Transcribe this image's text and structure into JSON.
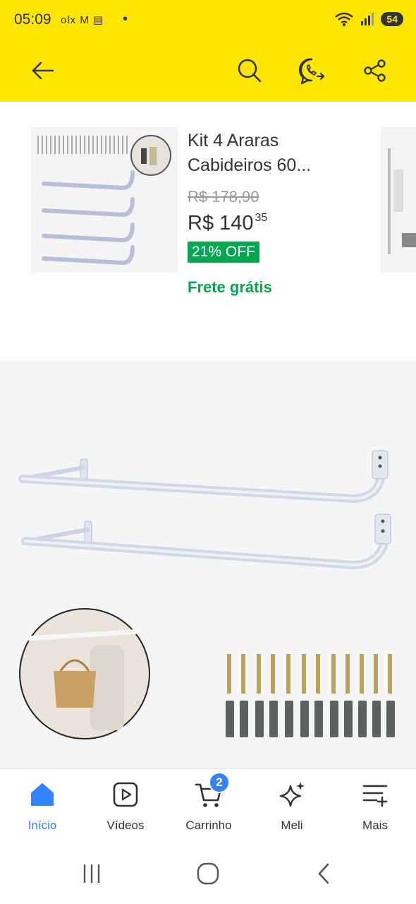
{
  "status_bar": {
    "time": "05:09",
    "notifications": "olx M ▤",
    "dot": "•",
    "battery": "54"
  },
  "app_bar": {
    "back_icon": "arrow-left-icon",
    "search_icon": "search-icon",
    "whatsapp_icon": "whatsapp-share-icon",
    "share_icon": "share-icon",
    "background_color": "#ffe600"
  },
  "recommendation": {
    "title": "Kit 4 Araras Cabideiros 60...",
    "old_price": "R$ 178,90",
    "price_main": "R$ 140",
    "price_cents": "35",
    "discount": "21% OFF",
    "shipping": "Frete grátis",
    "discount_color": "#00a650"
  },
  "bottom_nav": {
    "items": [
      {
        "label": "Início",
        "icon": "home-icon",
        "active": true
      },
      {
        "label": "Vídeos",
        "icon": "play-icon",
        "active": false
      },
      {
        "label": "Carrinho",
        "icon": "cart-icon",
        "active": false,
        "badge": "2"
      },
      {
        "label": "Meli",
        "icon": "sparkle-icon",
        "active": false
      },
      {
        "label": "Mais",
        "icon": "menu-plus-icon",
        "active": false
      }
    ],
    "accent_color": "#3483fa"
  },
  "system_nav": {
    "recents_icon": "recents-icon",
    "home_icon": "home-circle-icon",
    "back_icon": "back-chevron-icon"
  }
}
